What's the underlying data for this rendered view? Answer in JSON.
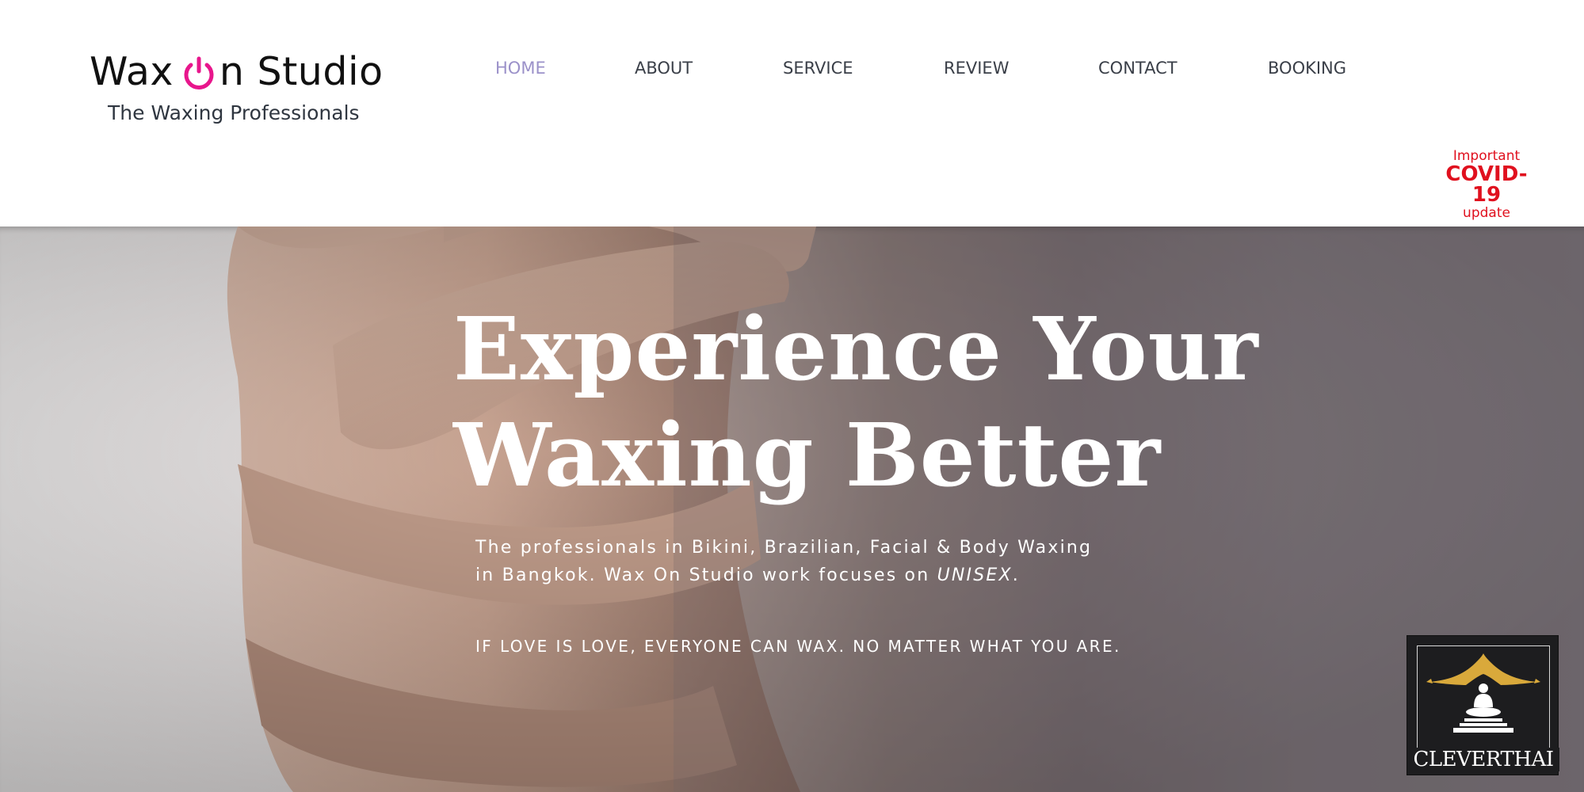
{
  "brand": {
    "name_part1": "Wax ",
    "name_part2": "n Studio",
    "tagline": "The Waxing Professionals",
    "accent_color": "#e8168c"
  },
  "nav": {
    "items": [
      {
        "label": "HOME",
        "active": true
      },
      {
        "label": "ABOUT",
        "active": false
      },
      {
        "label": "SERVICE",
        "active": false
      },
      {
        "label": "REVIEW",
        "active": false
      },
      {
        "label": "CONTACT",
        "active": false
      },
      {
        "label": "BOOKING",
        "active": false
      }
    ],
    "active_color": "#9b91c9",
    "text_color": "#3a3f48"
  },
  "covid_notice": {
    "line1": "Important",
    "line2": "COVID-19",
    "line3": "update",
    "color": "#e0101e"
  },
  "hero": {
    "title_line1": "Experience Your",
    "title_line2": "Waxing Better",
    "subtitle_line1": "The professionals in Bikini, Brazilian, Facial & Body Waxing",
    "subtitle_line2_prefix": "in Bangkok. Wax On Studio work focuses on ",
    "subtitle_line2_emphasis": "UNISEX",
    "subtitle_line2_suffix": ".",
    "motto": "IF LOVE IS LOVE, EVERYONE CAN WAX. NO MATTER WHAT YOU ARE."
  },
  "watermark": {
    "label": "CLEVERTHAI",
    "icon": "buddha-temple-icon"
  }
}
